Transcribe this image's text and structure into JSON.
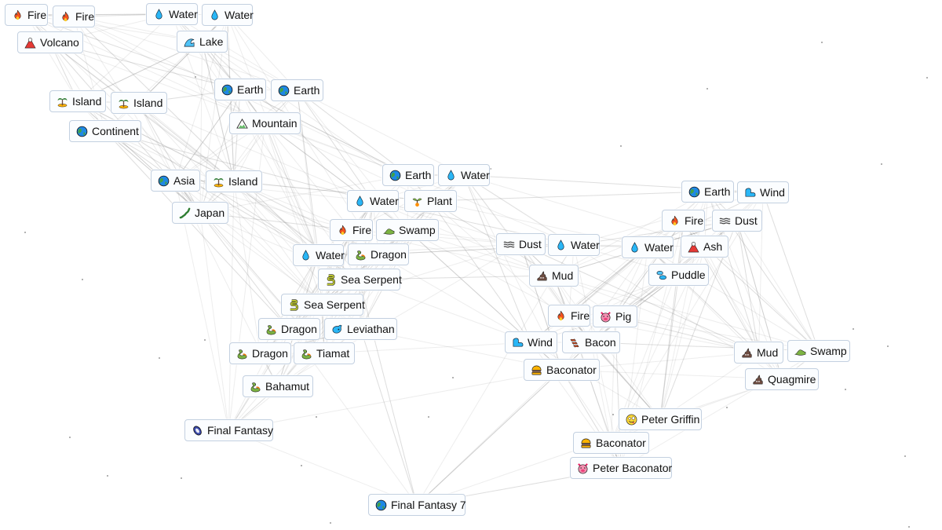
{
  "app": {
    "type": "crafting-canvas"
  },
  "icons": {
    "fire": "fire-icon",
    "water": "water-drop-icon",
    "volcano": "volcano-icon",
    "lake": "wave-icon",
    "earth": "globe-icon",
    "island": "desert-island-icon",
    "mountain": "mountain-icon",
    "continent": "globe-icon",
    "japan": "japan-map-icon",
    "plant": "seedling-icon",
    "swamp": "crocodile-icon",
    "dragon": "dragon-icon",
    "serpent": "snake-icon",
    "leviathan": "whale-icon",
    "final_fantasy": "crystal-icon",
    "dust": "fog-icon",
    "wind": "wind-icon",
    "ash": "volcano-icon",
    "mud": "poop-icon",
    "puddle": "droplets-icon",
    "pig": "pig-face-icon",
    "bacon": "bacon-icon",
    "burger": "hamburger-icon",
    "griffin": "zany-face-icon"
  },
  "tiles": [
    {
      "id": "t1",
      "label": "Fire",
      "icon": "fire"
    },
    {
      "id": "t2",
      "label": "Fire",
      "icon": "fire"
    },
    {
      "id": "t3",
      "label": "Volcano",
      "icon": "volcano"
    },
    {
      "id": "t4",
      "label": "Water",
      "icon": "water"
    },
    {
      "id": "t5",
      "label": "Water",
      "icon": "water"
    },
    {
      "id": "t6",
      "label": "Lake",
      "icon": "lake"
    },
    {
      "id": "t7",
      "label": "Island",
      "icon": "island"
    },
    {
      "id": "t8",
      "label": "Island",
      "icon": "island"
    },
    {
      "id": "t9",
      "label": "Continent",
      "icon": "earth"
    },
    {
      "id": "t10",
      "label": "Earth",
      "icon": "earth"
    },
    {
      "id": "t11",
      "label": "Earth",
      "icon": "earth"
    },
    {
      "id": "t12",
      "label": "Mountain",
      "icon": "mountain"
    },
    {
      "id": "t13",
      "label": "Asia",
      "icon": "earth"
    },
    {
      "id": "t14",
      "label": "Island",
      "icon": "island"
    },
    {
      "id": "t15",
      "label": "Japan",
      "icon": "japan"
    },
    {
      "id": "t16",
      "label": "Earth",
      "icon": "earth"
    },
    {
      "id": "t17",
      "label": "Water",
      "icon": "water"
    },
    {
      "id": "t18",
      "label": "Water",
      "icon": "water"
    },
    {
      "id": "t19",
      "label": "Plant",
      "icon": "plant"
    },
    {
      "id": "t20",
      "label": "Fire",
      "icon": "fire"
    },
    {
      "id": "t21",
      "label": "Swamp",
      "icon": "swamp"
    },
    {
      "id": "t22",
      "label": "Water",
      "icon": "water"
    },
    {
      "id": "t23",
      "label": "Dragon",
      "icon": "dragon"
    },
    {
      "id": "t24",
      "label": "Sea Serpent",
      "icon": "serpent"
    },
    {
      "id": "t25",
      "label": "Sea Serpent",
      "icon": "serpent"
    },
    {
      "id": "t26",
      "label": "Dragon",
      "icon": "dragon"
    },
    {
      "id": "t27",
      "label": "Leviathan",
      "icon": "leviathan"
    },
    {
      "id": "t28",
      "label": "Dragon",
      "icon": "dragon"
    },
    {
      "id": "t29",
      "label": "Tiamat",
      "icon": "dragon"
    },
    {
      "id": "t30",
      "label": "Bahamut",
      "icon": "dragon"
    },
    {
      "id": "t31",
      "label": "Final Fantasy",
      "icon": "final_fantasy"
    },
    {
      "id": "t32",
      "label": "Final Fantasy 7",
      "icon": "earth"
    },
    {
      "id": "t33",
      "label": "Earth",
      "icon": "earth"
    },
    {
      "id": "t34",
      "label": "Wind",
      "icon": "wind"
    },
    {
      "id": "t35",
      "label": "Fire",
      "icon": "fire"
    },
    {
      "id": "t36",
      "label": "Dust",
      "icon": "dust"
    },
    {
      "id": "t37",
      "label": "Dust",
      "icon": "dust"
    },
    {
      "id": "t38",
      "label": "Water",
      "icon": "water"
    },
    {
      "id": "t39",
      "label": "Water",
      "icon": "water"
    },
    {
      "id": "t40",
      "label": "Ash",
      "icon": "ash"
    },
    {
      "id": "t41",
      "label": "Mud",
      "icon": "mud"
    },
    {
      "id": "t42",
      "label": "Puddle",
      "icon": "puddle"
    },
    {
      "id": "t43",
      "label": "Fire",
      "icon": "fire"
    },
    {
      "id": "t44",
      "label": "Pig",
      "icon": "pig"
    },
    {
      "id": "t45",
      "label": "Wind",
      "icon": "wind"
    },
    {
      "id": "t46",
      "label": "Bacon",
      "icon": "bacon"
    },
    {
      "id": "t47",
      "label": "Baconator",
      "icon": "burger"
    },
    {
      "id": "t48",
      "label": "Mud",
      "icon": "mud"
    },
    {
      "id": "t49",
      "label": "Swamp",
      "icon": "swamp"
    },
    {
      "id": "t50",
      "label": "Quagmire",
      "icon": "mud"
    },
    {
      "id": "t51",
      "label": "Peter Griffin",
      "icon": "griffin"
    },
    {
      "id": "t52",
      "label": "Baconator",
      "icon": "burger"
    },
    {
      "id": "t53",
      "label": "Peter Baconator",
      "icon": "pig"
    }
  ],
  "recipes": [
    [
      "t1",
      "t2",
      "t3"
    ],
    [
      "t4",
      "t5",
      "t6"
    ],
    [
      "t3",
      "t6",
      "t7"
    ],
    [
      "t7",
      "t8",
      "t9"
    ],
    [
      "t10",
      "t11",
      "t12"
    ],
    [
      "t9",
      "t12",
      "t13"
    ],
    [
      "t13",
      "t14",
      "t15"
    ],
    [
      "t16",
      "t17",
      "t19"
    ],
    [
      "t18",
      "t19",
      "t21"
    ],
    [
      "t20",
      "t21",
      "t23"
    ],
    [
      "t22",
      "t23",
      "t24"
    ],
    [
      "t24",
      "t25",
      "t27"
    ],
    [
      "t26",
      "t27",
      "t29"
    ],
    [
      "t28",
      "t29",
      "t30"
    ],
    [
      "t15",
      "t30",
      "t31"
    ],
    [
      "t31",
      "t53",
      "t32"
    ],
    [
      "t33",
      "t34",
      "t36"
    ],
    [
      "t35",
      "t36",
      "t40"
    ],
    [
      "t39",
      "t40",
      "t42"
    ],
    [
      "t37",
      "t38",
      "t41"
    ],
    [
      "t43",
      "t44",
      "t46"
    ],
    [
      "t45",
      "t46",
      "t47"
    ],
    [
      "t48",
      "t49",
      "t50"
    ],
    [
      "t42",
      "t50",
      "t51"
    ],
    [
      "t47",
      "t51",
      "t52"
    ],
    [
      "t52",
      "t44",
      "t53"
    ]
  ]
}
